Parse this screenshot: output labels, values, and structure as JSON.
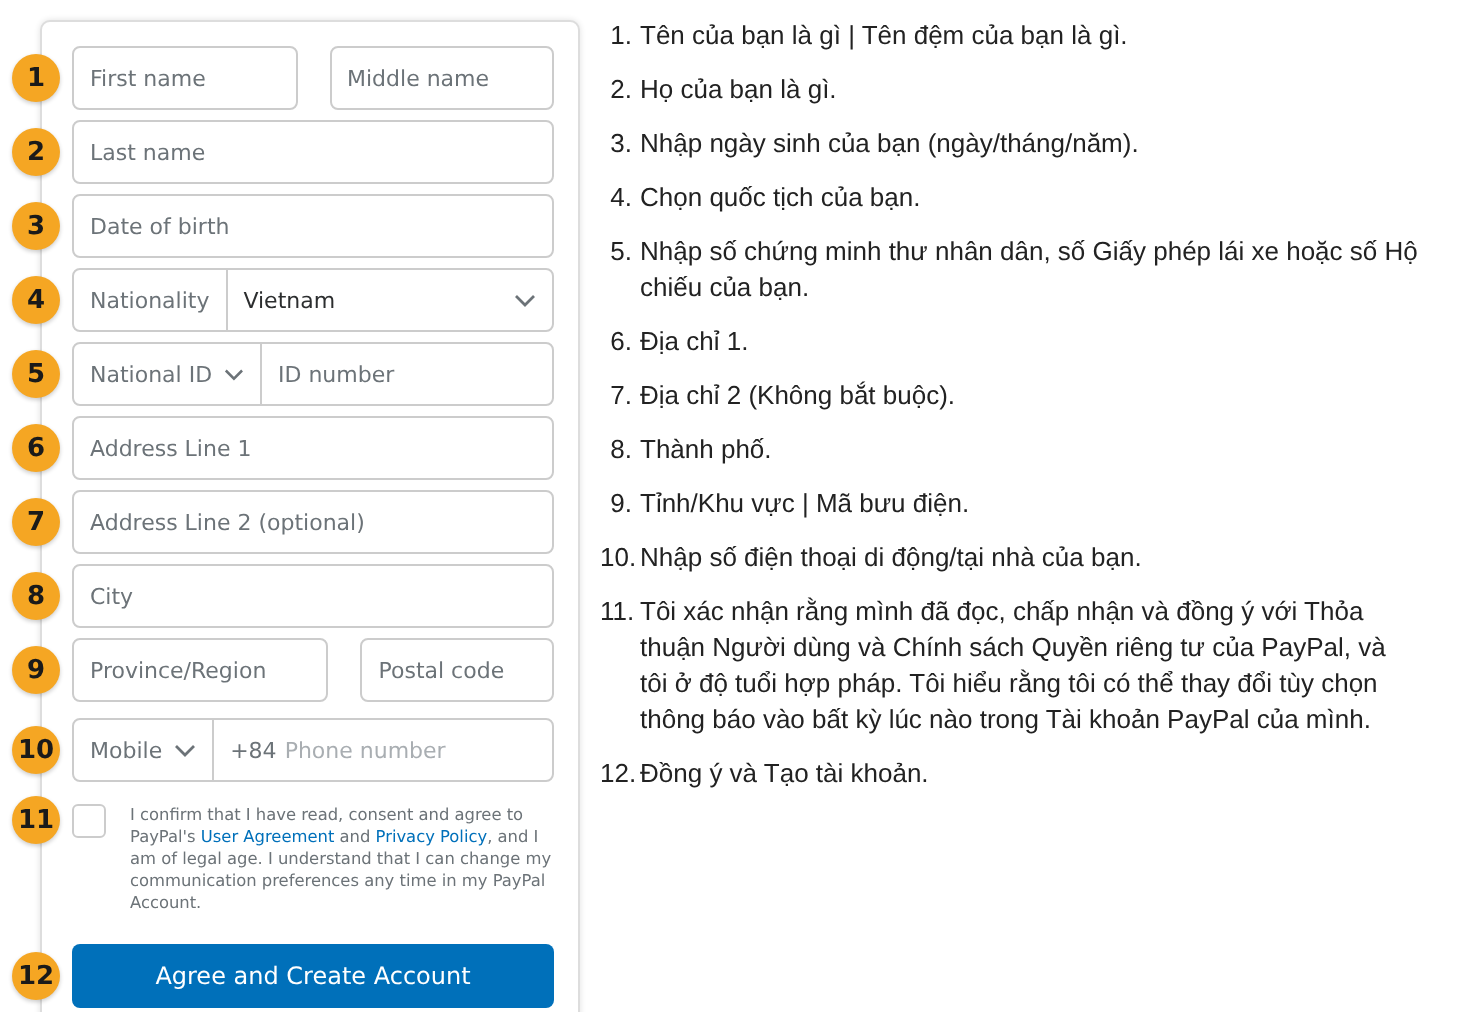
{
  "form": {
    "rows": [
      {
        "number": "1",
        "kind": "inputs",
        "inputs": [
          {
            "placeholder": "First name"
          },
          {
            "placeholder": "Middle name"
          }
        ]
      },
      {
        "number": "2",
        "kind": "inputs",
        "inputs": [
          {
            "placeholder": "Last name"
          }
        ]
      },
      {
        "number": "3",
        "kind": "inputs",
        "inputs": [
          {
            "placeholder": "Date of birth"
          }
        ]
      },
      {
        "number": "4",
        "kind": "labeled-select",
        "label": "Nationality",
        "value": "Vietnam"
      },
      {
        "number": "5",
        "kind": "select-input",
        "select": "National ID",
        "placeholder": "ID number"
      },
      {
        "number": "6",
        "kind": "inputs",
        "inputs": [
          {
            "placeholder": "Address Line 1"
          }
        ]
      },
      {
        "number": "7",
        "kind": "inputs",
        "inputs": [
          {
            "placeholder": "Address Line 2 (optional)"
          }
        ]
      },
      {
        "number": "8",
        "kind": "inputs",
        "inputs": [
          {
            "placeholder": "City"
          }
        ]
      },
      {
        "number": "9",
        "kind": "inputs",
        "inputs": [
          {
            "placeholder": "Province/Region"
          },
          {
            "placeholder": "Postal code"
          }
        ]
      },
      {
        "number": "10",
        "kind": "phone",
        "select": "Mobile",
        "prefix": "+84",
        "placeholder": "Phone number"
      },
      {
        "number": "11",
        "kind": "consent",
        "checked": false,
        "parts": [
          {
            "text": "I confirm that I have read, consent and agree to PayPal's ",
            "link": false
          },
          {
            "text": "User Agreement",
            "link": true
          },
          {
            "text": " and ",
            "link": false
          },
          {
            "text": "Privacy Policy",
            "link": true
          },
          {
            "text": ", and I am of legal age. I understand that I can change my communication preferences any time in my PayPal Account.",
            "link": false
          }
        ]
      },
      {
        "number": "12",
        "kind": "button",
        "label": "Agree and Create Account"
      }
    ]
  },
  "instructions": [
    {
      "number": "1.",
      "text": "Tên của bạn là gì | Tên đệm của bạn là gì."
    },
    {
      "number": "2.",
      "text": "Họ của bạn là gì."
    },
    {
      "number": "3.",
      "text": "Nhập ngày sinh của bạn (ngày/tháng/năm)."
    },
    {
      "number": "4.",
      "text": "Chọn quốc tịch của bạn."
    },
    {
      "number": "5.",
      "text": "Nhập số chứng minh thư nhân dân, số Giấy phép lái xe hoặc số Hộ chiếu của bạn."
    },
    {
      "number": "6.",
      "text": "Địa chỉ 1."
    },
    {
      "number": "7.",
      "text": "Địa chỉ 2 (Không bắt buộc)."
    },
    {
      "number": "8.",
      "text": "Thành phố."
    },
    {
      "number": "9.",
      "text": "Tỉnh/Khu vực | Mã bưu điện."
    },
    {
      "number": "10.",
      "text": "Nhập số điện thoại di động/tại nhà của bạn."
    },
    {
      "number": "11.",
      "text": "Tôi xác nhận rằng mình đã đọc, chấp nhận và đồng ý với Thỏa thuận Người dùng và Chính sách Quyền riêng tư của PayPal, và tôi ở độ tuổi hợp pháp. Tôi hiểu rằng tôi có thể thay đổi tùy chọn thông báo vào bất kỳ lúc nào trong Tài khoản PayPal của mình."
    },
    {
      "number": "12.",
      "text": "Đồng ý và Tạo tài khoản."
    }
  ]
}
